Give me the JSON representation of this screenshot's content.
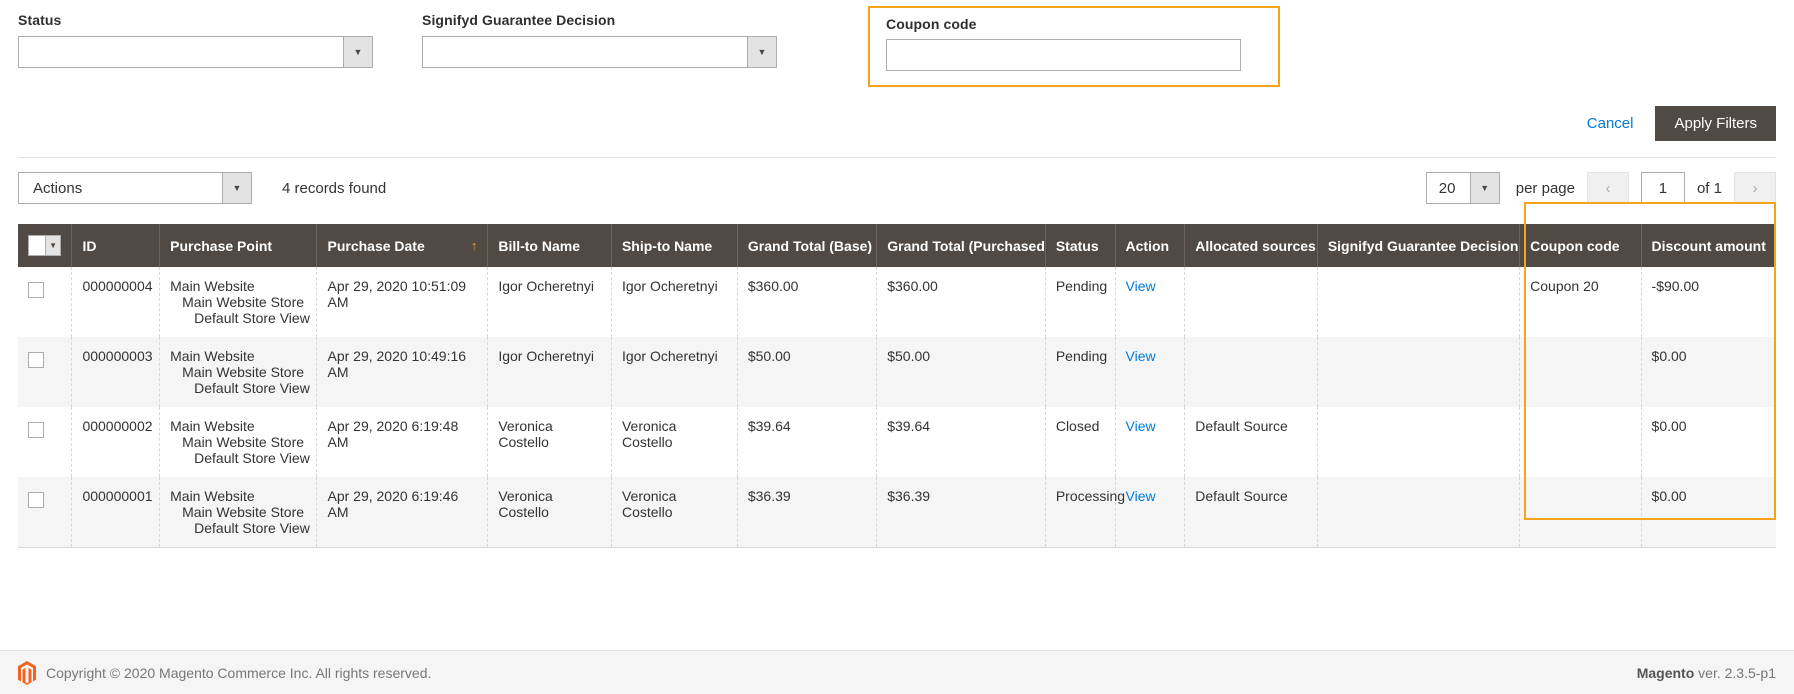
{
  "filters": {
    "status": {
      "label": "Status",
      "value": "",
      "icon": "chevron-down-icon"
    },
    "signifyd": {
      "label": "Signifyd Guarantee Decision",
      "value": "",
      "icon": "chevron-down-icon"
    },
    "coupon": {
      "label": "Coupon code",
      "value": "",
      "placeholder": ""
    },
    "cancel_label": "Cancel",
    "apply_label": "Apply Filters",
    "highlight_color": "#f5a31a"
  },
  "toolbar": {
    "actions_label": "Actions",
    "records_found": "4 records found",
    "per_page_value": "20",
    "per_page_label": "per page",
    "page_value": "1",
    "of_label": "of 1",
    "prev_icon": "chevron-left-icon",
    "next_icon": "chevron-right-icon"
  },
  "grid": {
    "columns": [
      {
        "label": "",
        "key": "checkbox"
      },
      {
        "label": "ID",
        "key": "id"
      },
      {
        "label": "Purchase Point",
        "key": "purchase_point"
      },
      {
        "label": "Purchase Date",
        "key": "purchase_date",
        "sort": "asc"
      },
      {
        "label": "Bill-to Name",
        "key": "bill_to"
      },
      {
        "label": "Ship-to Name",
        "key": "ship_to"
      },
      {
        "label": "Grand Total (Base)",
        "key": "grand_total_base"
      },
      {
        "label": "Grand Total (Purchased)",
        "key": "grand_total_purchased"
      },
      {
        "label": "Status",
        "key": "status"
      },
      {
        "label": "Action",
        "key": "action"
      },
      {
        "label": "Allocated sources",
        "key": "allocated_sources"
      },
      {
        "label": "Signifyd Guarantee Decision",
        "key": "signifyd"
      },
      {
        "label": "Coupon code",
        "key": "coupon_code"
      },
      {
        "label": "Discount amount",
        "key": "discount_amount"
      }
    ],
    "sort_asc_glyph": "↑",
    "rows": [
      {
        "id": "000000004",
        "pp1": "Main Website",
        "pp2": "Main Website Store",
        "pp3": "Default Store View",
        "purchase_date": "Apr 29, 2020 10:51:09 AM",
        "bill_to": "Igor Ocheretnyi",
        "ship_to": "Igor Ocheretnyi",
        "grand_total_base": "$360.00",
        "grand_total_purchased": "$360.00",
        "status": "Pending",
        "action": "View",
        "allocated_sources": "",
        "signifyd": "",
        "coupon_code": "Coupon 20",
        "discount_amount": "-$90.00"
      },
      {
        "id": "000000003",
        "pp1": "Main Website",
        "pp2": "Main Website Store",
        "pp3": "Default Store View",
        "purchase_date": "Apr 29, 2020 10:49:16 AM",
        "bill_to": "Igor Ocheretnyi",
        "ship_to": "Igor Ocheretnyi",
        "grand_total_base": "$50.00",
        "grand_total_purchased": "$50.00",
        "status": "Pending",
        "action": "View",
        "allocated_sources": "",
        "signifyd": "",
        "coupon_code": "",
        "discount_amount": "$0.00"
      },
      {
        "id": "000000002",
        "pp1": "Main Website",
        "pp2": "Main Website Store",
        "pp3": "Default Store View",
        "purchase_date": "Apr 29, 2020 6:19:48 AM",
        "bill_to": "Veronica Costello",
        "ship_to": "Veronica Costello",
        "grand_total_base": "$39.64",
        "grand_total_purchased": "$39.64",
        "status": "Closed",
        "action": "View",
        "allocated_sources": "Default Source",
        "signifyd": "",
        "coupon_code": "",
        "discount_amount": "$0.00"
      },
      {
        "id": "000000001",
        "pp1": "Main Website",
        "pp2": "Main Website Store",
        "pp3": "Default Store View",
        "purchase_date": "Apr 29, 2020 6:19:46 AM",
        "bill_to": "Veronica Costello",
        "ship_to": "Veronica Costello",
        "grand_total_base": "$36.39",
        "grand_total_purchased": "$36.39",
        "status": "Processing",
        "action": "View",
        "allocated_sources": "Default Source",
        "signifyd": "",
        "coupon_code": "",
        "discount_amount": "$0.00"
      }
    ]
  },
  "footer": {
    "copyright": "Copyright © 2020 Magento Commerce Inc. All rights reserved.",
    "brand": "Magento",
    "version": " ver. 2.3.5-p1",
    "logo_icon": "magento-logo-icon"
  }
}
